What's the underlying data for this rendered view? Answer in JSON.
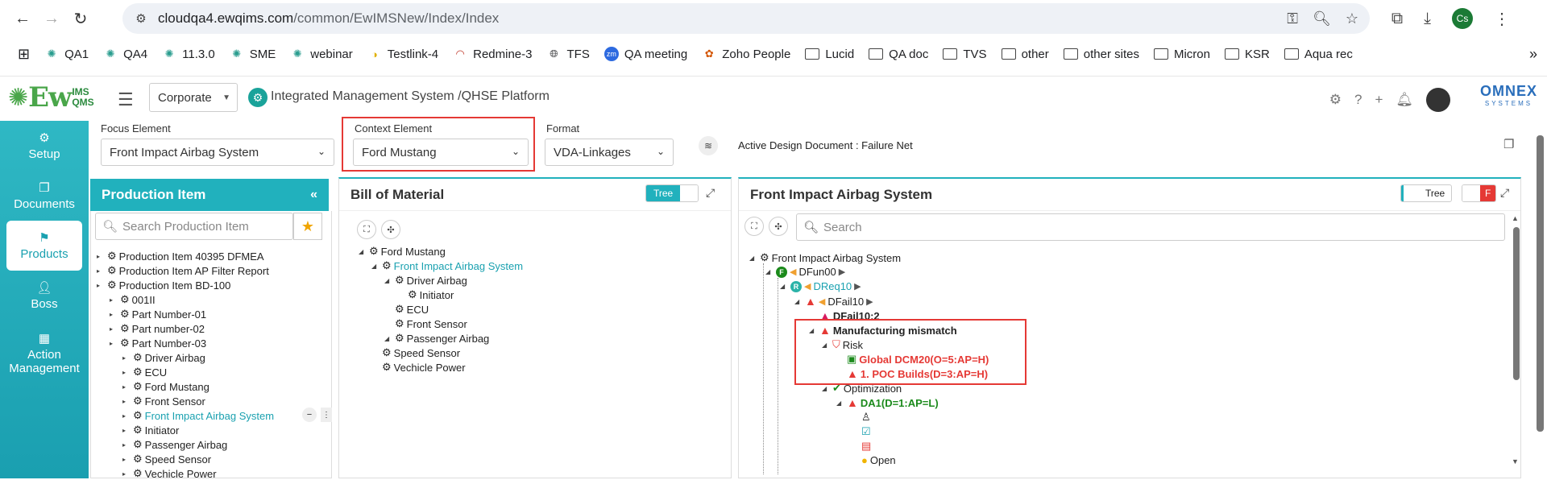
{
  "browser": {
    "url_host": "cloudqa4.ewqims.com",
    "url_path": "/common/EwIMSNew/Index/Index",
    "profile_initials": "Cs"
  },
  "bookmarks": [
    "QA1",
    "QA4",
    "11.3.0",
    "SME",
    "webinar",
    "Testlink-4",
    "Redmine-3",
    "TFS",
    "QA meeting",
    "Zoho People",
    "Lucid",
    "QA doc",
    "TVS",
    "other",
    "other sites",
    "Micron",
    "KSR",
    "Aqua rec"
  ],
  "app": {
    "logo_text": "Ew",
    "logo_ims": "IMS",
    "logo_qms": "QMS",
    "org_select": "Corporate",
    "title": "Integrated Management System /QHSE Platform",
    "brand": "OMNEX",
    "brand_sub": "SYSTEMS"
  },
  "sidebar": [
    {
      "label": "Setup",
      "icon": "gears-icon"
    },
    {
      "label": "Documents",
      "icon": "documents-icon"
    },
    {
      "label": "Products",
      "icon": "products-icon"
    },
    {
      "label": "Boss",
      "icon": "boss-icon"
    },
    {
      "label": "Action Management",
      "icon": "building-icon"
    }
  ],
  "filters": {
    "focus_label": "Focus Element",
    "focus_value": "Front Impact Airbag System",
    "context_label": "Context Element",
    "context_value": "Ford Mustang",
    "format_label": "Format",
    "format_value": "VDA-Linkages",
    "active_doc": "Active Design Document : Failure Net"
  },
  "production": {
    "title": "Production Item",
    "search_placeholder": "Search Production Item",
    "items": [
      "Production Item 40395 DFMEA",
      "Production Item AP Filter Report",
      "Production Item BD-100",
      "001II",
      "Part Number-01",
      "Part number-02",
      "Part Number-03",
      "Driver Airbag",
      "ECU",
      "Ford Mustang",
      "Front Sensor",
      "Front Impact Airbag System",
      "Initiator",
      "Passenger Airbag",
      "Speed Sensor",
      "Vechicle Power"
    ]
  },
  "bom": {
    "title": "Bill of Material",
    "toggle": "Tree",
    "items": [
      "Ford Mustang",
      "Front Impact Airbag System",
      "Driver Airbag",
      "Initiator",
      "ECU",
      "Front Sensor",
      "Passenger Airbag",
      "Speed Sensor",
      "Vechicle Power"
    ]
  },
  "net": {
    "title": "Front Impact Airbag System",
    "toggle": "Tree",
    "toggle_f": "F",
    "search_placeholder": "Search",
    "root": "Front Impact Airbag System",
    "fun": "DFun00",
    "req": "DReq10",
    "fail": "DFail10",
    "fail2": "DFail10:2",
    "mismatch": "Manufacturing mismatch",
    "risk": "Risk",
    "global": "Global DCM20(O=5:AP=H)",
    "poc": "1. POC Builds(D=3:AP=H)",
    "optimization": "Optimization",
    "da1": "DA1(D=1:AP=L)",
    "open": "Open",
    "badge_f": "F",
    "badge_r": "R"
  }
}
